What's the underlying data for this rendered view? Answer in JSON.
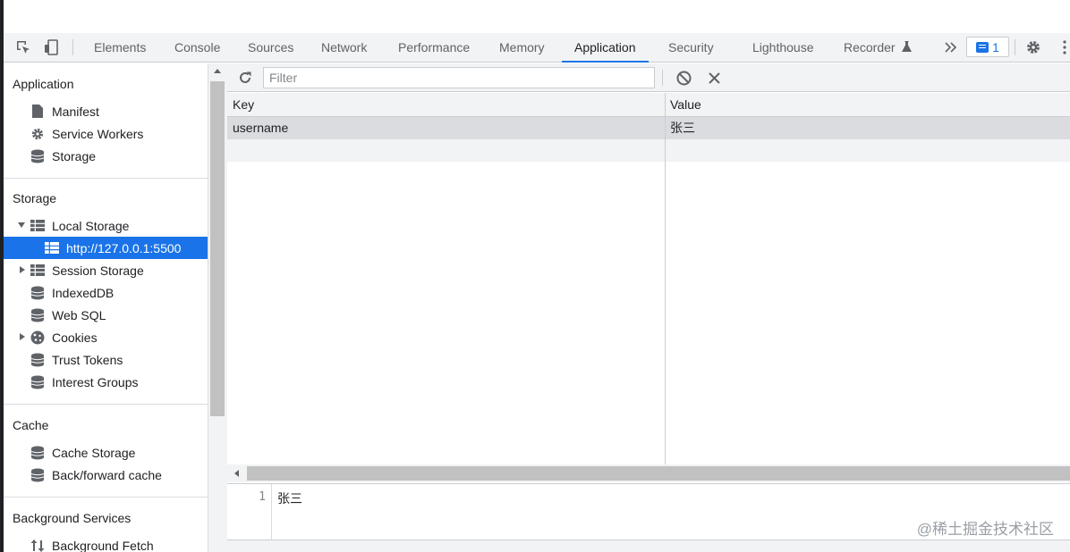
{
  "tabs": [
    "Elements",
    "Console",
    "Sources",
    "Network",
    "Performance",
    "Memory",
    "Application",
    "Security",
    "Lighthouse",
    "Recorder"
  ],
  "active_tab": "Application",
  "issues_count": "1",
  "sidebar": {
    "application": {
      "title": "Application",
      "items": [
        "Manifest",
        "Service Workers",
        "Storage"
      ]
    },
    "storage": {
      "title": "Storage",
      "local_storage": "Local Storage",
      "local_origin": "http://127.0.0.1:5500",
      "session_storage": "Session Storage",
      "indexeddb": "IndexedDB",
      "websql": "Web SQL",
      "cookies": "Cookies",
      "trust_tokens": "Trust Tokens",
      "interest_groups": "Interest Groups"
    },
    "cache": {
      "title": "Cache",
      "items": [
        "Cache Storage",
        "Back/forward cache"
      ]
    },
    "background": {
      "title": "Background Services",
      "items": [
        "Background Fetch"
      ]
    }
  },
  "toolbar": {
    "filter_placeholder": "Filter"
  },
  "table": {
    "headers": {
      "key": "Key",
      "value": "Value"
    },
    "rows": [
      {
        "key": "username",
        "value": "张三"
      }
    ]
  },
  "preview": {
    "line_number": "1",
    "text": "张三"
  },
  "watermark": "@稀土掘金技术社区",
  "colors": {
    "accent": "#1a73e8",
    "panel_bg": "#f1f3f4",
    "selected_row": "#dadce0"
  }
}
